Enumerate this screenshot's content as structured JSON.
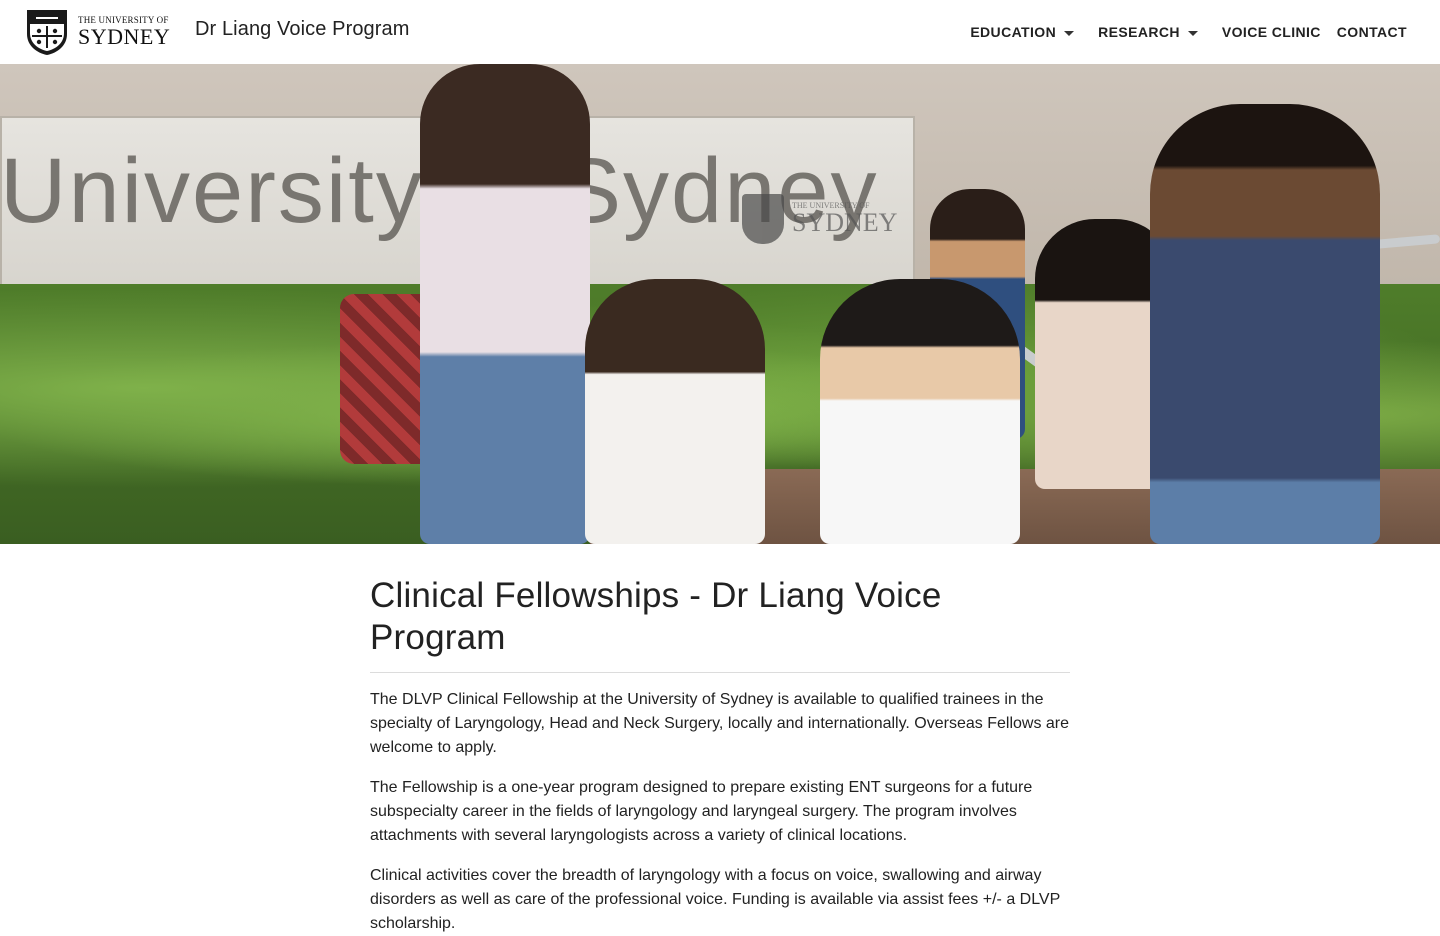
{
  "header": {
    "logo": {
      "top_line": "THE UNIVERSITY OF",
      "bottom_line": "SYDNEY"
    },
    "site_title": "Dr Liang Voice Program",
    "nav": [
      {
        "label": "EDUCATION",
        "has_dropdown": true
      },
      {
        "label": "RESEARCH",
        "has_dropdown": true
      },
      {
        "label": "VOICE CLINIC",
        "has_dropdown": false
      },
      {
        "label": "CONTACT",
        "has_dropdown": false
      }
    ]
  },
  "hero": {
    "sign_text": "University of Sydney",
    "sign_logo_top": "THE UNIVERSITY OF",
    "sign_logo_bottom": "SYDNEY"
  },
  "main": {
    "title": "Clinical Fellowships - Dr Liang Voice Program",
    "paragraphs": [
      "The DLVP Clinical Fellowship at the University of Sydney is available to qualified trainees in the specialty of Laryngology, Head and Neck Surgery, locally and internationally. Overseas Fellows are welcome to apply.",
      "The Fellowship is a one-year program designed to prepare existing ENT surgeons for a future subspecialty career in the fields of laryngology and laryngeal surgery. The program involves attachments with several laryngologists across a variety of clinical locations.",
      "Clinical activities cover the breadth of laryngology with a focus on voice, swallowing and airway disorders as well as care of the professional voice. Funding is available via assist fees +/- a DLVP scholarship."
    ]
  }
}
